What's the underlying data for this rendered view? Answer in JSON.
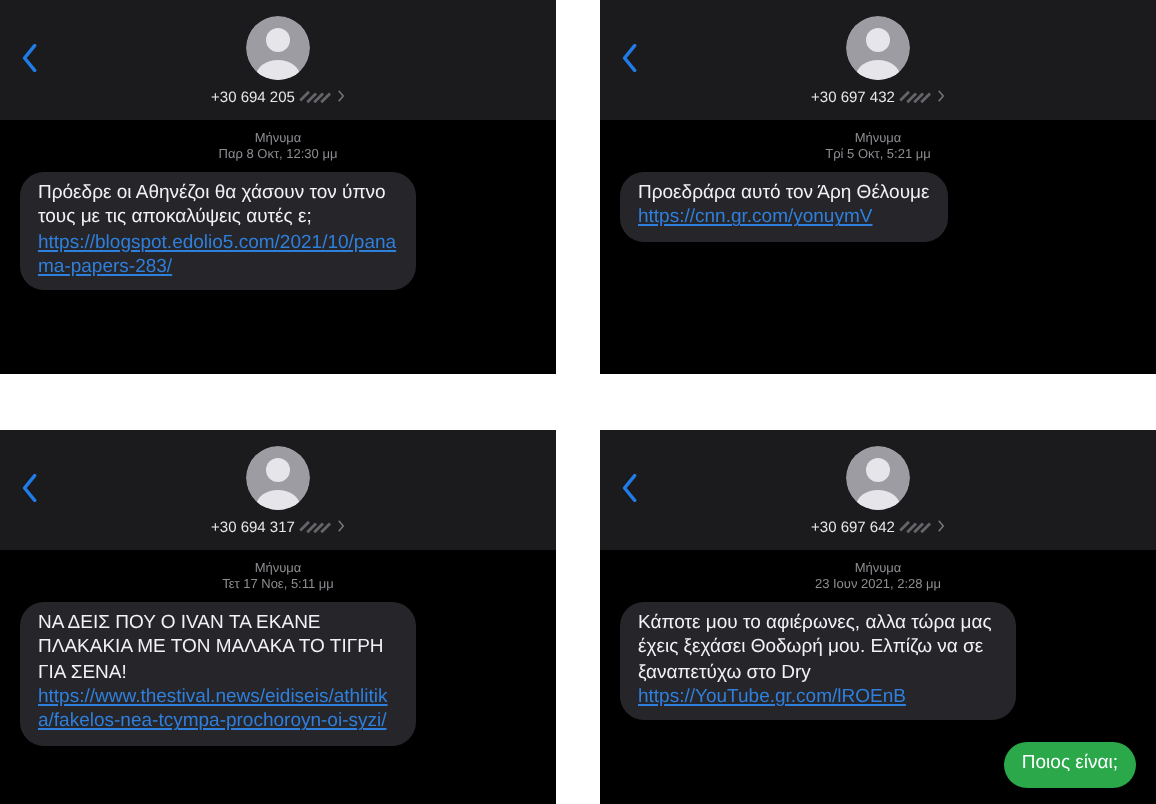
{
  "conversations": [
    {
      "contact": "+30 694 205",
      "heading": "Μήνυμα",
      "date": "Παρ 8 Οκτ, 12:30 μμ",
      "messages": [
        {
          "kind": "incoming",
          "text": "Πρόεδρε οι Αθηνέζοι θα χάσουν τον ύπνο τους με τις αποκαλύψεις αυτές ε;",
          "link": "https://blogspot.edolio5.com/2021/10/panama-papers-283/"
        }
      ]
    },
    {
      "contact": "+30 697 432",
      "heading": "Μήνυμα",
      "date": "Τρί 5 Οκτ, 5:21 μμ",
      "messages": [
        {
          "kind": "incoming",
          "text": "Προεδράρα αυτό τον Άρη Θέλουμε",
          "link": "https://cnn.gr.com/yonuymV"
        }
      ]
    },
    {
      "contact": "+30 694 317",
      "heading": "Μήνυμα",
      "date": "Τετ 17 Νοε, 5:11 μμ",
      "messages": [
        {
          "kind": "incoming",
          "text": "ΝΑ ΔΕΙΣ ΠΟΥ Ο IVAN ΤΑ ΕΚΑΝΕ ΠΛΑΚΑΚΙΑ ΜΕ ΤΟΝ ΜΑΛΑΚΑ ΤΟ ΤΙΓΡΗ ΓΙΑ ΣΕΝΑ!",
          "link": "https://www.thestival.news/eidiseis/athlitika/fakelos-nea-tcympa-prochoroyn-oi-syzi/"
        }
      ]
    },
    {
      "contact": "+30 697 642",
      "heading": "Μήνυμα",
      "date": "23 Ιουν 2021, 2:28 μμ",
      "messages": [
        {
          "kind": "incoming",
          "text": "Κάποτε μου το αφιέρωνες, αλλα τώρα μας έχεις ξεχάσει Θοδωρή μου. Ελπίζω να σε ξαναπετύχω στο Dry",
          "link": "https://YouTube.gr.com/lROEnB"
        },
        {
          "kind": "outgoing",
          "text": "Ποιος είναι;"
        }
      ]
    }
  ]
}
